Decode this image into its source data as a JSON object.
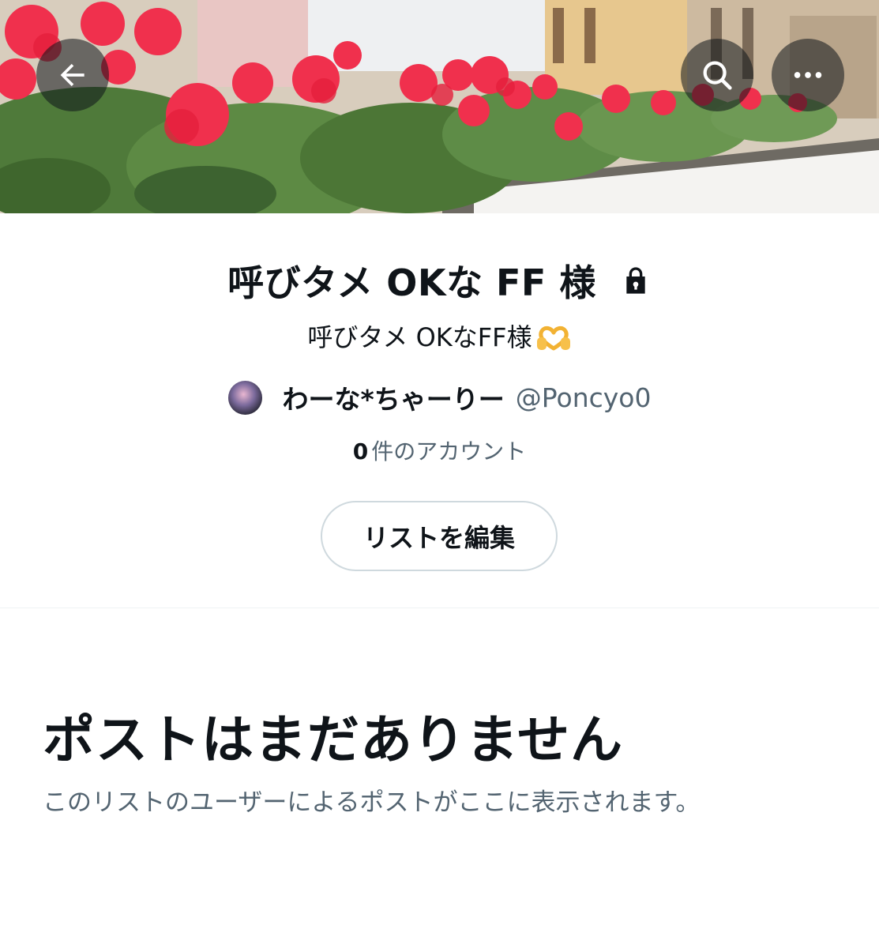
{
  "header": {
    "back_icon": "arrow-left-icon",
    "search_icon": "search-icon",
    "more_icon": "more-horizontal-icon"
  },
  "list": {
    "title": "呼びタメ OKな FF 様",
    "private_icon": "lock-icon",
    "description": "呼びタメ OKなFF様",
    "description_emoji": "heart-hands-emoji",
    "owner_name": "わーな*ちゃーりー",
    "owner_handle": "@Poncyo0",
    "member_count": "0",
    "member_label": "件のアカウント",
    "edit_button": "リストを編集"
  },
  "empty_state": {
    "title": "ポストはまだありません",
    "subtitle": "このリストのユーザーによるポストがここに表示されます。"
  },
  "colors": {
    "text_primary": "#0f1419",
    "text_secondary": "#536471",
    "border": "#cfd9de",
    "banner_flower": "#f0304d"
  }
}
